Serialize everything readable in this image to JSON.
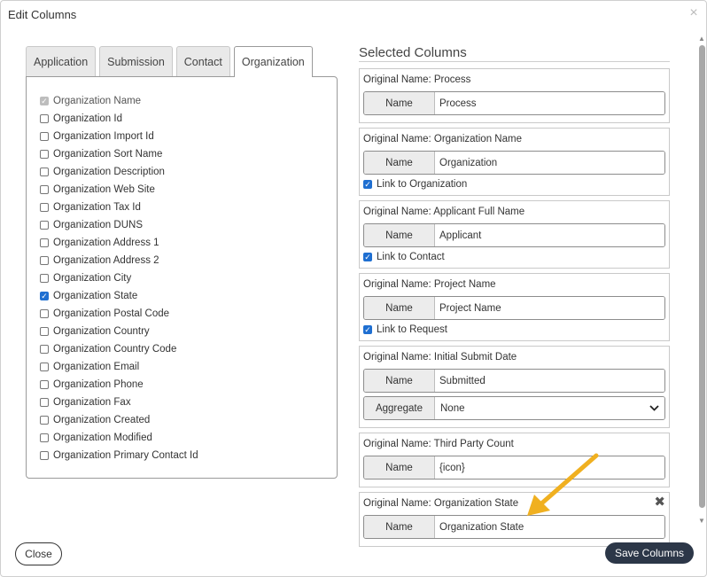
{
  "dialog": {
    "title": "Edit Columns",
    "close_glyph": "×"
  },
  "tabs": [
    {
      "label": "Application",
      "active": false
    },
    {
      "label": "Submission",
      "active": false
    },
    {
      "label": "Contact",
      "active": false
    },
    {
      "label": "Organization",
      "active": true
    }
  ],
  "fields": [
    {
      "label": "Organization Name",
      "checked": true,
      "disabled": true
    },
    {
      "label": "Organization Id",
      "checked": false
    },
    {
      "label": "Organization Import Id",
      "checked": false
    },
    {
      "label": "Organization Sort Name",
      "checked": false
    },
    {
      "label": "Organization Description",
      "checked": false
    },
    {
      "label": "Organization Web Site",
      "checked": false
    },
    {
      "label": "Organization Tax Id",
      "checked": false
    },
    {
      "label": "Organization DUNS",
      "checked": false
    },
    {
      "label": "Organization Address 1",
      "checked": false
    },
    {
      "label": "Organization Address 2",
      "checked": false
    },
    {
      "label": "Organization City",
      "checked": false
    },
    {
      "label": "Organization State",
      "checked": true
    },
    {
      "label": "Organization Postal Code",
      "checked": false
    },
    {
      "label": "Organization Country",
      "checked": false
    },
    {
      "label": "Organization Country Code",
      "checked": false
    },
    {
      "label": "Organization Email",
      "checked": false
    },
    {
      "label": "Organization Phone",
      "checked": false
    },
    {
      "label": "Organization Fax",
      "checked": false
    },
    {
      "label": "Organization Created",
      "checked": false
    },
    {
      "label": "Organization Modified",
      "checked": false
    },
    {
      "label": "Organization Primary Contact Id",
      "checked": false
    }
  ],
  "selected": {
    "heading": "Selected Columns",
    "name_label": "Name",
    "aggregate_label": "Aggregate",
    "columns": [
      {
        "original": "Original Name: Process",
        "name": "Process"
      },
      {
        "original": "Original Name: Organization Name",
        "name": "Organization",
        "link": "Link to Organization",
        "link_checked": true
      },
      {
        "original": "Original Name: Applicant Full Name",
        "name": "Applicant",
        "link": "Link to Contact",
        "link_checked": true
      },
      {
        "original": "Original Name: Project Name",
        "name": "Project Name",
        "link": "Link to Request",
        "link_checked": true
      },
      {
        "original": "Original Name: Initial Submit Date",
        "name": "Submitted",
        "aggregate": "None"
      },
      {
        "original": "Original Name: Third Party Count",
        "name": "{icon}"
      },
      {
        "original": "Original Name: Organization State",
        "name": "Organization State",
        "removable": true,
        "remove_glyph": "✖"
      }
    ]
  },
  "footer": {
    "close_label": "Close",
    "save_label": "Save Columns"
  },
  "colors": {
    "accent": "#1f6fd1",
    "save_bg": "#2c3748",
    "arrow": "#f0b020"
  },
  "icons": {
    "dialog_close": "close-icon",
    "remove": "remove-column-icon",
    "select_chevron": "chevron-down-icon",
    "annotation": "arrow-annotation-icon"
  }
}
